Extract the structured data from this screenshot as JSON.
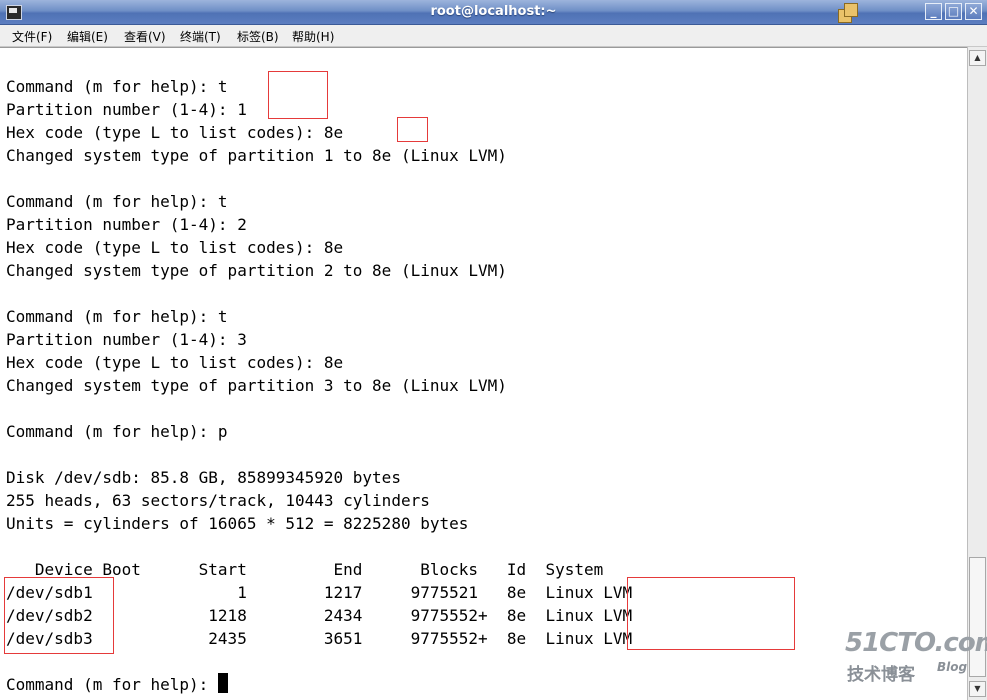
{
  "window": {
    "title": "root@localhost:~"
  },
  "menu": [
    "文件(F)",
    "编辑(E)",
    "查看(V)",
    "终端(T)",
    "标签(B)",
    "帮助(H)"
  ],
  "terminal": {
    "lines": [
      "Command (m for help): t",
      "Partition number (1-4): 1",
      "Hex code (type L to list codes): 8e",
      "Changed system type of partition 1 to 8e (Linux LVM)",
      "",
      "Command (m for help): t",
      "Partition number (1-4): 2",
      "Hex code (type L to list codes): 8e",
      "Changed system type of partition 2 to 8e (Linux LVM)",
      "",
      "Command (m for help): t",
      "Partition number (1-4): 3",
      "Hex code (type L to list codes): 8e",
      "Changed system type of partition 3 to 8e (Linux LVM)",
      "",
      "Command (m for help): p",
      "",
      "Disk /dev/sdb: 85.8 GB, 85899345920 bytes",
      "255 heads, 63 sectors/track, 10443 cylinders",
      "Units = cylinders of 16065 * 512 = 8225280 bytes",
      "",
      "   Device Boot      Start         End      Blocks   Id  System",
      "/dev/sdb1               1        1217     9775521   8e  Linux LVM",
      "/dev/sdb2            1218        2434     9775552+  8e  Linux LVM",
      "/dev/sdb3            2435        3651     9775552+  8e  Linux LVM",
      ""
    ],
    "prompt": "Command (m for help): "
  },
  "watermark": {
    "site": "51CTO.com",
    "label": "技术博客",
    "blog": "Blog"
  }
}
